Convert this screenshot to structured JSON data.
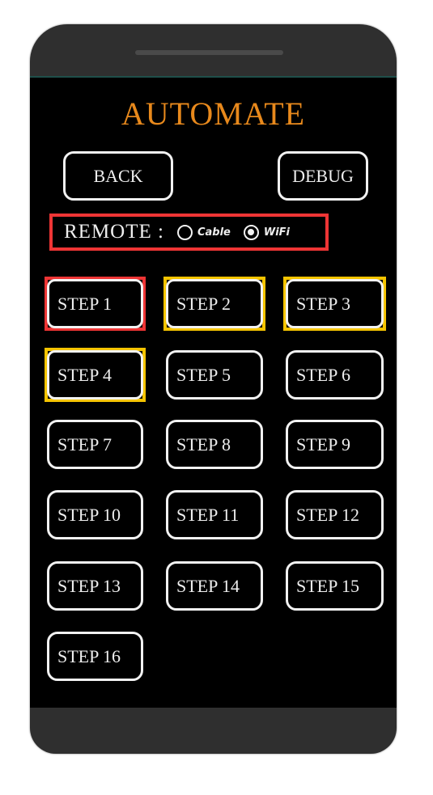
{
  "app": {
    "title": "AUTOMATE"
  },
  "header_buttons": {
    "back_label": "BACK",
    "debug_label": "DEBUG"
  },
  "remote": {
    "label": "REMOTE :",
    "options": [
      {
        "label": "Cable",
        "selected": false
      },
      {
        "label": "WiFi",
        "selected": true
      }
    ]
  },
  "steps": [
    {
      "label": "STEP 1",
      "highlight": "red"
    },
    {
      "label": "STEP 2",
      "highlight": "yellow"
    },
    {
      "label": "STEP 3",
      "highlight": "yellow"
    },
    {
      "label": "STEP 4",
      "highlight": "yellow"
    },
    {
      "label": "STEP 5",
      "highlight": "none"
    },
    {
      "label": "STEP 6",
      "highlight": "none"
    },
    {
      "label": "STEP 7",
      "highlight": "none"
    },
    {
      "label": "STEP 8",
      "highlight": "none"
    },
    {
      "label": "STEP 9",
      "highlight": "none"
    },
    {
      "label": "STEP 10",
      "highlight": "none"
    },
    {
      "label": "STEP 11",
      "highlight": "none"
    },
    {
      "label": "STEP 12",
      "highlight": "none"
    },
    {
      "label": "STEP 13",
      "highlight": "none"
    },
    {
      "label": "STEP 14",
      "highlight": "none"
    },
    {
      "label": "STEP 15",
      "highlight": "none"
    },
    {
      "label": "STEP 16",
      "highlight": "none"
    }
  ],
  "colors": {
    "title": "#e8891c",
    "highlight_red": "#ee3535",
    "highlight_yellow": "#f5c400"
  }
}
